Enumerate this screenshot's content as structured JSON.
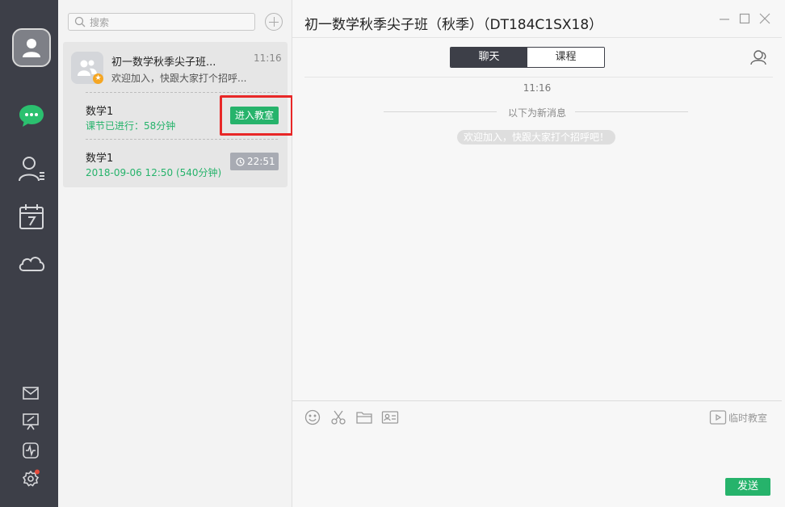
{
  "search": {
    "placeholder": "搜索"
  },
  "group": {
    "name": "初一数学秋季尖子班...",
    "time": "11:16",
    "last_message": "欢迎加入，快跟大家打个招呼...",
    "star_glyph": "★"
  },
  "lessons": [
    {
      "title": "数学1",
      "status": "课节已进行：58分钟",
      "action_label": "进入教室"
    },
    {
      "title": "数学1",
      "status": "2018-09-06 12:50 (540分钟)",
      "countdown": "22:51"
    }
  ],
  "chat": {
    "title": "初一数学秋季尖子班（秋季）（DT184C1SX18）",
    "tabs": [
      {
        "label": "聊天",
        "active": true
      },
      {
        "label": "课程",
        "active": false
      }
    ],
    "message_time": "11:16",
    "new_messages_label": "以下为新消息",
    "system_message": "欢迎加入，快跟大家打个招呼吧！",
    "temp_classroom_label": "临时教室",
    "send_label": "发送"
  },
  "colors": {
    "rail": "#3d3f48",
    "accent_green": "#26b36b",
    "highlight_red": "#e82727",
    "badge_orange": "#f5a623"
  },
  "icons": {
    "rail": [
      "chat-icon",
      "contacts-icon",
      "calendar-icon",
      "cloud-icon",
      "mail-icon",
      "whiteboard-icon",
      "activity-icon",
      "settings-icon"
    ],
    "composer": [
      "emoji-icon",
      "scissors-icon",
      "folder-icon",
      "id-card-icon",
      "video-icon"
    ]
  }
}
